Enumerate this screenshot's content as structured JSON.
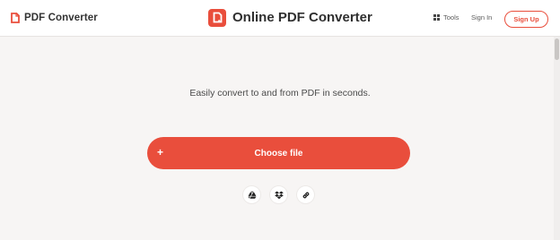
{
  "header": {
    "brand_name": "PDF Converter",
    "app_title": "Online PDF Converter",
    "tools_label": "Tools",
    "signin_label": "Sign In",
    "signup_label": "Sign Up"
  },
  "main": {
    "tagline": "Easily convert to and from PDF in seconds.",
    "upload_plus": "+",
    "upload_label": "Choose file",
    "cloud_sources": [
      "google-drive-icon",
      "dropbox-icon",
      "link-icon"
    ]
  },
  "colors": {
    "accent": "#e94e3c",
    "background": "#f7f5f4",
    "header_bg": "#ffffff"
  }
}
